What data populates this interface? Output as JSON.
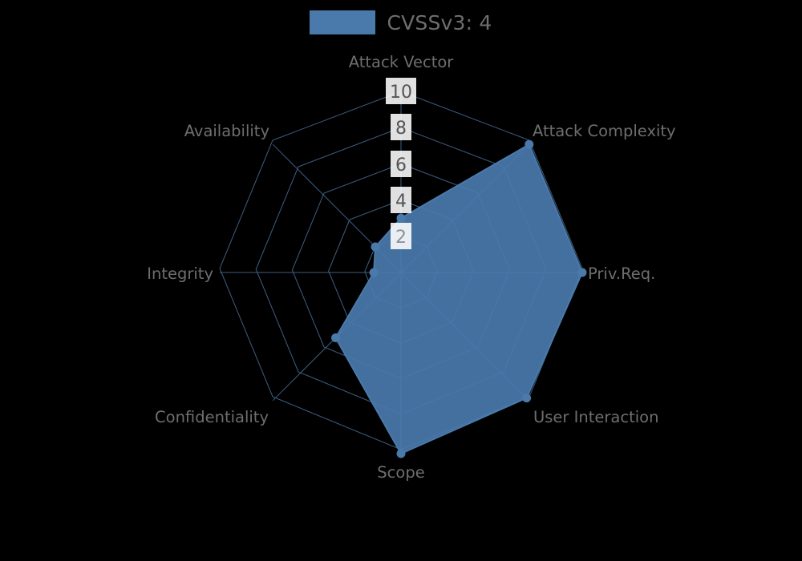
{
  "legend": {
    "label": "CVSSv3: 4",
    "swatch_color": "#4a7aac"
  },
  "colors": {
    "background": "#000000",
    "series": "#4a7aac",
    "grid": "#3d5f80",
    "text": "#6e6e6e",
    "tick_text": "#555555",
    "tick_label_background": "#ffffff"
  },
  "axis_labels": {
    "attack_vector": "Attack Vector",
    "attack_complexity": "Attack Complexity",
    "priv_req": "Priv.Req.",
    "user_interaction": "User Interaction",
    "scope": "Scope",
    "confidentiality": "Confidentiality",
    "integrity": "Integrity",
    "availability": "Availability"
  },
  "ticks": {
    "t10": "10",
    "t8": "8",
    "t6": "6",
    "t4": "4",
    "t2": "2"
  },
  "chart_data": {
    "type": "line",
    "chart_style": "radar",
    "title": "",
    "categories": [
      "Attack Vector",
      "Attack Complexity",
      "Priv.Req.",
      "User Interaction",
      "Scope",
      "Confidentiality",
      "Integrity",
      "Availability"
    ],
    "series": [
      {
        "name": "CVSSv3: 4",
        "color": "#4a7aac",
        "values": [
          3.0,
          10.0,
          10.0,
          9.8,
          10.0,
          5.1,
          1.5,
          2.0
        ]
      }
    ],
    "rlim": [
      0,
      10
    ],
    "rticks": [
      2,
      4,
      6,
      8,
      10
    ],
    "tick_labels": [
      "2",
      "4",
      "6",
      "8",
      "10"
    ],
    "grid": true,
    "legend_position": "top-center",
    "angle_start_deg": 90,
    "angle_direction": "clockwise"
  }
}
